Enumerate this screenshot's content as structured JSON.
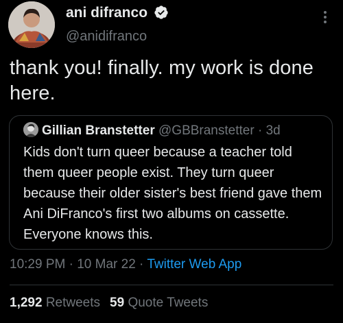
{
  "author": {
    "display_name": "ani difranco",
    "handle": "@anidifranco",
    "verified_icon": "verified-badge-icon"
  },
  "tweet": {
    "text": "thank you! finally. my work is done here."
  },
  "quoted_tweet": {
    "display_name": "Gillian Branstetter",
    "handle": "@GBBranstetter",
    "separator": "·",
    "date": "3d",
    "text": "Kids don't turn queer because a teacher told them queer people exist. They turn queer because their older sister's best friend gave them Ani DiFranco's first two albums on cassette. Everyone knows this."
  },
  "meta": {
    "time": "10:29 PM",
    "separator1": "·",
    "date": "10 Mar 22",
    "separator2": "·",
    "source": "Twitter Web App"
  },
  "stats": {
    "retweets_count": "1,292",
    "retweets_label": "Retweets",
    "quotes_count": "59",
    "quotes_label": "Quote Tweets"
  },
  "colors": {
    "background": "#000000",
    "text": "#e7e9ea",
    "muted": "#71767b",
    "link": "#1d9bf0",
    "border": "#2f3336"
  }
}
